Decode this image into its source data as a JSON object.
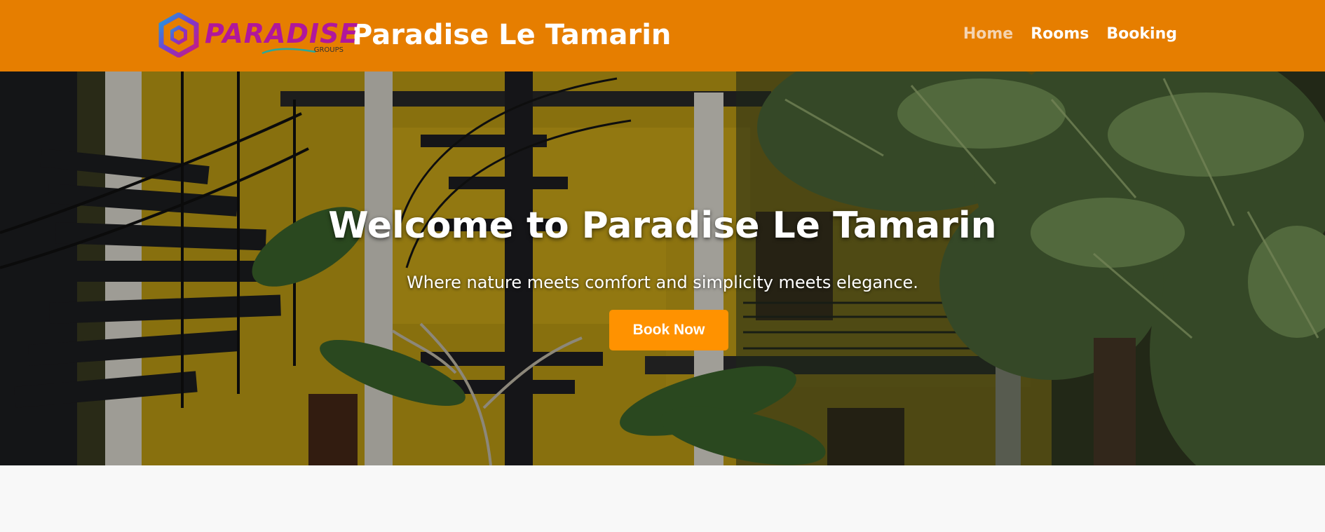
{
  "header": {
    "logo": {
      "word": "PARADISE",
      "sub": "GROUPS",
      "icon": "hexagon-logo-icon"
    },
    "site_title": "Paradise Le Tamarin",
    "nav": [
      {
        "label": "Home",
        "active": true
      },
      {
        "label": "Rooms",
        "active": false
      },
      {
        "label": "Booking",
        "active": false
      }
    ]
  },
  "hero": {
    "title": "Welcome to Paradise Le Tamarin",
    "subtitle": "Where nature meets comfort and simplicity meets elegance.",
    "cta_label": "Book Now",
    "image": "hotel-courtyard-with-spiral-staircases-and-palms"
  },
  "colors": {
    "navbar": "#e67e00",
    "cta": "#ff9200",
    "active_nav": "#f4d3b0",
    "page_bg": "#f8f8f8"
  }
}
